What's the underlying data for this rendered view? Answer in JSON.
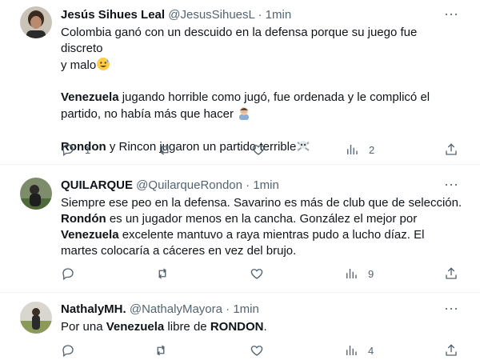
{
  "tweets": [
    {
      "name": "Jesús Sihues Leal",
      "handle": "@JesusSihuesL",
      "dot": "·",
      "time": "1min",
      "more": "···",
      "lines": {
        "l1": "Colombia ganó con un descuido en la defensa porque su juego fue discreto",
        "l2": "y malo",
        "l3_bold": "Venezuela",
        "l3": " jugando horrible como jugó, fue ordenada y le complicó el",
        "l4": "partido, no había más que hacer",
        "l5_bold": "Rondon",
        "l5": " y Rincon jugaron un partido terrible"
      },
      "replies": "1",
      "retweets": "",
      "likes": "",
      "views": "2"
    },
    {
      "name": "QUILARQUE",
      "handle": "@QuilarqueRondon",
      "dot": "·",
      "time": "1min",
      "more": "···",
      "lines": {
        "l1": "Siempre ese peo en la defensa. Savarino es más de club que de selección.",
        "l2_bold": "Rondón",
        "l2": " es un jugador menos en la cancha. González el mejor por",
        "l3_bold": "Venezuela",
        "l3": " excelente mantuvo a raya mientras pudo a lucho díaz.  El",
        "l4": "martes colocaría a cáceres en vez del brujo."
      },
      "replies": "",
      "retweets": "",
      "likes": "",
      "views": "9"
    },
    {
      "name": "NathalyMH.",
      "handle": "@NathalyMayora",
      "dot": "·",
      "time": "1min",
      "more": "···",
      "lines": {
        "pre": "Por una ",
        "b1": "Venezuela",
        "mid": " libre de ",
        "b2": "RONDON",
        "post": "."
      },
      "replies": "",
      "retweets": "",
      "likes": "",
      "views": "4"
    }
  ]
}
